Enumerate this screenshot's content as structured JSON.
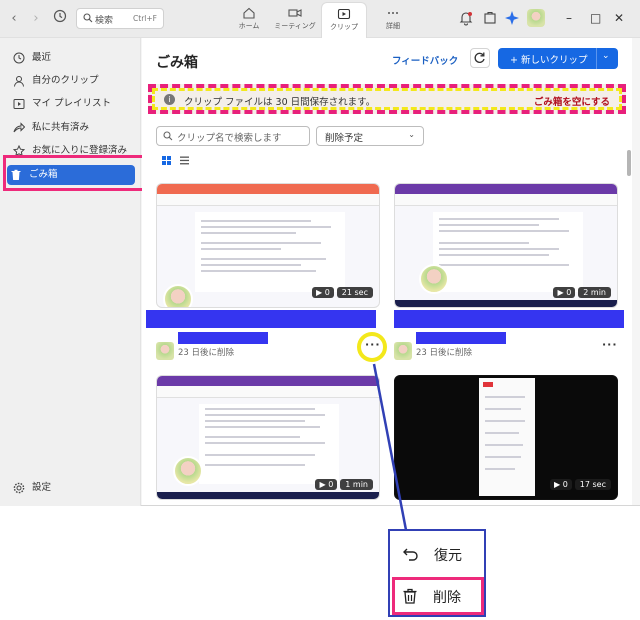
{
  "titlebar": {
    "search_label": "検索",
    "search_shortcut": "Ctrl+F",
    "tabs": [
      {
        "label": "ホーム",
        "icon": "home-icon"
      },
      {
        "label": "ミーティング",
        "icon": "video-icon"
      },
      {
        "label": "クリップ",
        "icon": "clip-icon",
        "active": true
      },
      {
        "label": "詳細",
        "icon": "more-icon"
      }
    ]
  },
  "sidebar": {
    "items": [
      {
        "label": "最近",
        "icon": "clock-icon"
      },
      {
        "label": "自分のクリップ",
        "icon": "person-icon"
      },
      {
        "label": "マイ プレイリスト",
        "icon": "playlist-icon"
      },
      {
        "label": "私に共有済み",
        "icon": "share-icon"
      },
      {
        "label": "お気に入りに登録済み",
        "icon": "star-icon"
      },
      {
        "label": "ごみ箱",
        "icon": "trash-icon",
        "active": true
      }
    ],
    "settings_label": "設定"
  },
  "main": {
    "title": "ごみ箱",
    "feedback": "フィードバック",
    "new_clip": "+ 新しいクリップ",
    "banner_message": "クリップ ファイルは 30 日間保存されます。",
    "empty_trash": "ごみ箱を空にする",
    "filter_placeholder": "クリップ名で検索します",
    "sort_label": "削除予定"
  },
  "clips": [
    {
      "views": "0",
      "duration": "21 sec",
      "deleted_note": "23 日後に削除"
    },
    {
      "views": "0",
      "duration": "2 min",
      "deleted_note": "23 日後に削除"
    },
    {
      "views": "0",
      "duration": "1 min"
    },
    {
      "views": "0",
      "duration": "17 sec"
    }
  ],
  "context_menu": {
    "restore": "復元",
    "delete": "削除"
  },
  "colors": {
    "accent": "#1668e3",
    "sidebar_active": "#2b6cd9",
    "highlight_pink": "#ee2a7b",
    "highlight_yellow": "#f3e81b",
    "redaction": "#3535f0"
  }
}
